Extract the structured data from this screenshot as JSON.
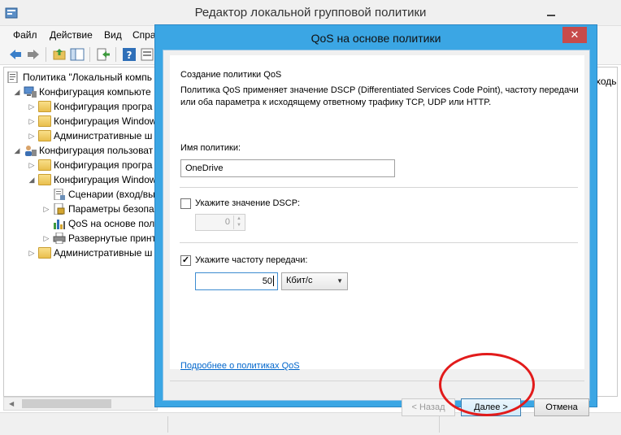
{
  "main_window": {
    "title": "Редактор локальной групповой политики",
    "menu": [
      "Файл",
      "Действие",
      "Вид",
      "Спра"
    ],
    "right_pane_text": "ходь"
  },
  "tree": [
    {
      "label": "Политика \"Локальный компь",
      "level": 0,
      "arrow": "",
      "icon": "policy-icon"
    },
    {
      "label": "Конфигурация компьюте",
      "level": 1,
      "arrow": "◢",
      "icon": "computer-icon"
    },
    {
      "label": "Конфигурация програ",
      "level": 2,
      "arrow": "▷",
      "icon": "folder-icon"
    },
    {
      "label": "Конфигурация Window",
      "level": 2,
      "arrow": "▷",
      "icon": "folder-icon"
    },
    {
      "label": "Административные ш",
      "level": 2,
      "arrow": "▷",
      "icon": "folder-icon"
    },
    {
      "label": "Конфигурация пользоват",
      "level": 1,
      "arrow": "◢",
      "icon": "user-icon"
    },
    {
      "label": "Конфигурация програ",
      "level": 2,
      "arrow": "▷",
      "icon": "folder-icon"
    },
    {
      "label": "Конфигурация Window",
      "level": 2,
      "arrow": "◢",
      "icon": "folder-icon"
    },
    {
      "label": "Сценарии (вход/вы",
      "level": 3,
      "arrow": "",
      "icon": "script-icon"
    },
    {
      "label": "Параметры безопа",
      "level": 3,
      "arrow": "▷",
      "icon": "security-icon"
    },
    {
      "label": "QoS на основе пол",
      "level": 3,
      "arrow": "",
      "icon": "chart-icon"
    },
    {
      "label": "Развернутые принт",
      "level": 3,
      "arrow": "▷",
      "icon": "printer-icon"
    },
    {
      "label": "Административные ш",
      "level": 2,
      "arrow": "▷",
      "icon": "folder-icon"
    }
  ],
  "dialog": {
    "title": "QoS на основе политики",
    "close_glyph": "✕",
    "heading": "Создание политики QoS",
    "description_line1": "Политика QoS применяет значение DSCP (Differentiated Services Code Point), частоту передачи",
    "description_line2": "или оба параметра к исходящему ответному трафику TCP, UDP или HTTP.",
    "policy_name_label": "Имя политики:",
    "policy_name_value": "OneDrive",
    "dscp_label": "Укажите значение DSCP:",
    "dscp_checked": false,
    "dscp_value": "0",
    "rate_label": "Укажите частоту передачи:",
    "rate_checked": true,
    "rate_value": "50",
    "rate_unit": "Кбит/с",
    "more_link": "Подробнее о политиках QoS",
    "back_button": "< Назад",
    "next_button": "Далее >",
    "cancel_button": "Отмена"
  },
  "colors": {
    "dialog_frame": "#3ba6e4",
    "close_button": "#c74b4b",
    "annotation_circle": "#e21b1b",
    "link": "#0066cc"
  }
}
